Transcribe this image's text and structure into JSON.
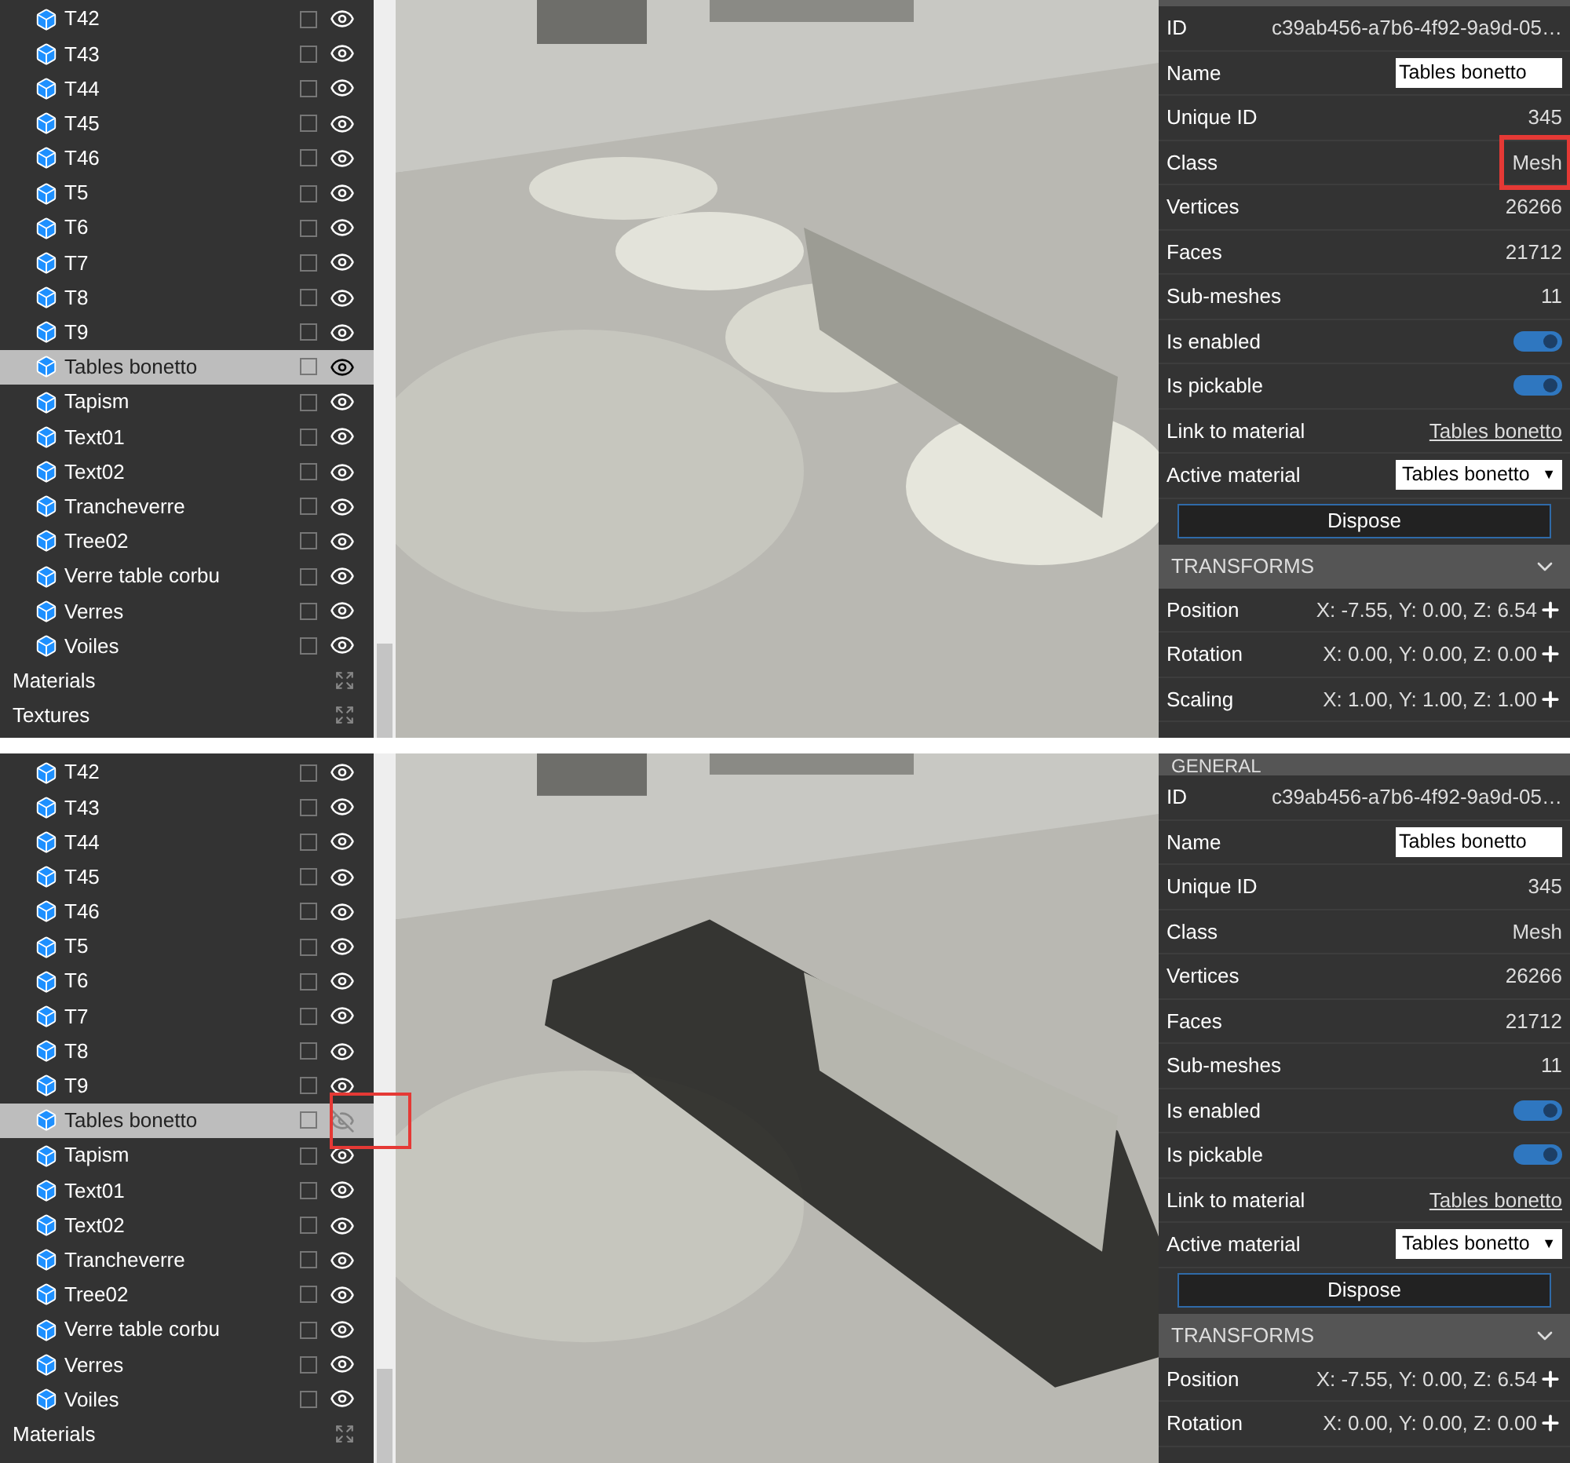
{
  "panes": [
    {
      "tree": {
        "items": [
          {
            "label": "T42",
            "selected": false,
            "visible": true,
            "highlighted": false
          },
          {
            "label": "T43",
            "selected": false,
            "visible": true,
            "highlighted": false
          },
          {
            "label": "T44",
            "selected": false,
            "visible": true,
            "highlighted": false
          },
          {
            "label": "T45",
            "selected": false,
            "visible": true,
            "highlighted": false
          },
          {
            "label": "T46",
            "selected": false,
            "visible": true,
            "highlighted": false
          },
          {
            "label": "T5",
            "selected": false,
            "visible": true,
            "highlighted": false
          },
          {
            "label": "T6",
            "selected": false,
            "visible": true,
            "highlighted": false
          },
          {
            "label": "T7",
            "selected": false,
            "visible": true,
            "highlighted": false
          },
          {
            "label": "T8",
            "selected": false,
            "visible": true,
            "highlighted": false
          },
          {
            "label": "T9",
            "selected": false,
            "visible": true,
            "highlighted": false
          },
          {
            "label": "Tables bonetto",
            "selected": true,
            "visible": true,
            "highlighted": false
          },
          {
            "label": "Tapism",
            "selected": false,
            "visible": true,
            "highlighted": false
          },
          {
            "label": "Text01",
            "selected": false,
            "visible": true,
            "highlighted": false
          },
          {
            "label": "Text02",
            "selected": false,
            "visible": true,
            "highlighted": false
          },
          {
            "label": "Trancheverre",
            "selected": false,
            "visible": true,
            "highlighted": false
          },
          {
            "label": "Tree02",
            "selected": false,
            "visible": true,
            "highlighted": false
          },
          {
            "label": "Verre table corbu",
            "selected": false,
            "visible": true,
            "highlighted": false
          },
          {
            "label": "Verres",
            "selected": false,
            "visible": true,
            "highlighted": false
          },
          {
            "label": "Voiles",
            "selected": false,
            "visible": true,
            "highlighted": false
          }
        ],
        "sections": [
          {
            "label": "Materials"
          },
          {
            "label": "Textures"
          }
        ]
      },
      "inspector": {
        "properties": [
          {
            "kind": "text",
            "label": "ID",
            "value": "c39ab456-a7b6-4f92-9a9d-05…",
            "highlighted": false
          },
          {
            "kind": "input",
            "label": "Name",
            "value": "Tables bonetto",
            "highlighted": false
          },
          {
            "kind": "text",
            "label": "Unique ID",
            "value": "345",
            "highlighted": false
          },
          {
            "kind": "text",
            "label": "Class",
            "value": "Mesh",
            "highlighted": true
          },
          {
            "kind": "text",
            "label": "Vertices",
            "value": "26266",
            "highlighted": false
          },
          {
            "kind": "text",
            "label": "Faces",
            "value": "21712",
            "highlighted": false
          },
          {
            "kind": "text",
            "label": "Sub-meshes",
            "value": "11",
            "highlighted": false
          },
          {
            "kind": "toggle",
            "label": "Is enabled",
            "on": true,
            "highlighted": false
          },
          {
            "kind": "toggle",
            "label": "Is pickable",
            "on": true,
            "highlighted": false
          },
          {
            "kind": "link",
            "label": "Link to material",
            "value": "Tables bonetto",
            "highlighted": false
          },
          {
            "kind": "select",
            "label": "Active material",
            "value": "Tables bonetto",
            "caret": "▼",
            "highlighted": false
          }
        ],
        "dispose_button": "Dispose",
        "transforms": {
          "title": "TRANSFORMS",
          "expanded": true,
          "rows": [
            {
              "label": "Position",
              "value": "X: -7.55, Y: 0.00, Z: 6.54"
            },
            {
              "label": "Rotation",
              "value": "X: 0.00, Y: 0.00, Z: 0.00"
            },
            {
              "label": "Scaling",
              "value": "X: 1.00, Y: 1.00, Z: 1.00"
            }
          ]
        }
      }
    },
    {
      "tree": {
        "items": [
          {
            "label": "T42",
            "selected": false,
            "visible": true,
            "highlighted": false
          },
          {
            "label": "T43",
            "selected": false,
            "visible": true,
            "highlighted": false
          },
          {
            "label": "T44",
            "selected": false,
            "visible": true,
            "highlighted": false
          },
          {
            "label": "T45",
            "selected": false,
            "visible": true,
            "highlighted": false
          },
          {
            "label": "T46",
            "selected": false,
            "visible": true,
            "highlighted": false
          },
          {
            "label": "T5",
            "selected": false,
            "visible": true,
            "highlighted": false
          },
          {
            "label": "T6",
            "selected": false,
            "visible": true,
            "highlighted": false
          },
          {
            "label": "T7",
            "selected": false,
            "visible": true,
            "highlighted": false
          },
          {
            "label": "T8",
            "selected": false,
            "visible": true,
            "highlighted": false
          },
          {
            "label": "T9",
            "selected": false,
            "visible": true,
            "highlighted": false
          },
          {
            "label": "Tables bonetto",
            "selected": true,
            "visible": false,
            "highlighted": true
          },
          {
            "label": "Tapism",
            "selected": false,
            "visible": true,
            "highlighted": false
          },
          {
            "label": "Text01",
            "selected": false,
            "visible": true,
            "highlighted": false
          },
          {
            "label": "Text02",
            "selected": false,
            "visible": true,
            "highlighted": false
          },
          {
            "label": "Trancheverre",
            "selected": false,
            "visible": true,
            "highlighted": false
          },
          {
            "label": "Tree02",
            "selected": false,
            "visible": true,
            "highlighted": false
          },
          {
            "label": "Verre table corbu",
            "selected": false,
            "visible": true,
            "highlighted": false
          },
          {
            "label": "Verres",
            "selected": false,
            "visible": true,
            "highlighted": false
          },
          {
            "label": "Voiles",
            "selected": false,
            "visible": true,
            "highlighted": false
          }
        ],
        "sections": [
          {
            "label": "Materials"
          }
        ]
      },
      "inspector": {
        "general_header": "GENERAL",
        "properties": [
          {
            "kind": "text",
            "label": "ID",
            "value": "c39ab456-a7b6-4f92-9a9d-05…",
            "highlighted": false
          },
          {
            "kind": "input",
            "label": "Name",
            "value": "Tables bonetto",
            "highlighted": false
          },
          {
            "kind": "text",
            "label": "Unique ID",
            "value": "345",
            "highlighted": false
          },
          {
            "kind": "text",
            "label": "Class",
            "value": "Mesh",
            "highlighted": false
          },
          {
            "kind": "text",
            "label": "Vertices",
            "value": "26266",
            "highlighted": false
          },
          {
            "kind": "text",
            "label": "Faces",
            "value": "21712",
            "highlighted": false
          },
          {
            "kind": "text",
            "label": "Sub-meshes",
            "value": "11",
            "highlighted": false
          },
          {
            "kind": "toggle",
            "label": "Is enabled",
            "on": true,
            "highlighted": false
          },
          {
            "kind": "toggle",
            "label": "Is pickable",
            "on": true,
            "highlighted": false
          },
          {
            "kind": "link",
            "label": "Link to material",
            "value": "Tables bonetto",
            "highlighted": false
          },
          {
            "kind": "select",
            "label": "Active material",
            "value": "Tables bonetto",
            "caret": "▼",
            "highlighted": false
          }
        ],
        "dispose_button": "Dispose",
        "transforms": {
          "title": "TRANSFORMS",
          "expanded": true,
          "rows": [
            {
              "label": "Position",
              "value": "X: -7.55, Y: 0.00, Z: 6.54"
            },
            {
              "label": "Rotation",
              "value": "X: 0.00, Y: 0.00, Z: 0.00"
            }
          ]
        }
      }
    }
  ]
}
